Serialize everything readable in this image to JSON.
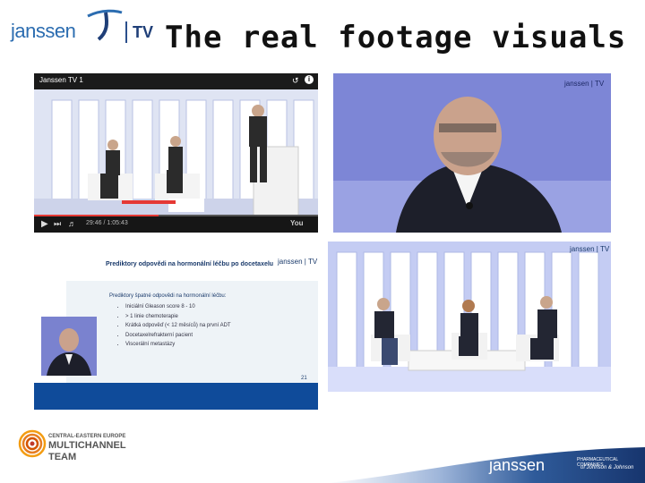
{
  "header": {
    "logo_brand": "janssen",
    "logo_tv": "TV",
    "title": "The real footage visuals"
  },
  "panels": {
    "player": {
      "channel_title": "Janssen TV 1",
      "time": "29:46 / 1:05:43",
      "progress_fraction": 0.44
    },
    "closeup": {
      "watermark": "janssen | TV"
    },
    "slide": {
      "watermark": "janssen | TV",
      "heading": "Prediktory odpovědi na hormonální léčbu po docetaxelu",
      "subheading": "Prediktory špatné odpovědi na hormonální léčbu:",
      "bullets": [
        "Iniciální Gleason score 8 - 10",
        "> 1 linie chemoterapie",
        "Krátká odpověď (< 12 měsíců) na první ADT",
        "Docetaxelrefrakterní pacient",
        "Viscerální metastázy"
      ],
      "page_number": "21"
    },
    "panel_wide": {
      "watermark": "janssen | TV"
    }
  },
  "footer": {
    "cee_line1": "CENTRAL-EASTERN EUROPE",
    "cee_line2": "MULTICHANNEL",
    "cee_line3": "TEAM",
    "janssen": "janssen",
    "pharma_line": "PHARMACEUTICAL COMPANIES",
    "jj_line": "of Johnson & Johnson"
  }
}
